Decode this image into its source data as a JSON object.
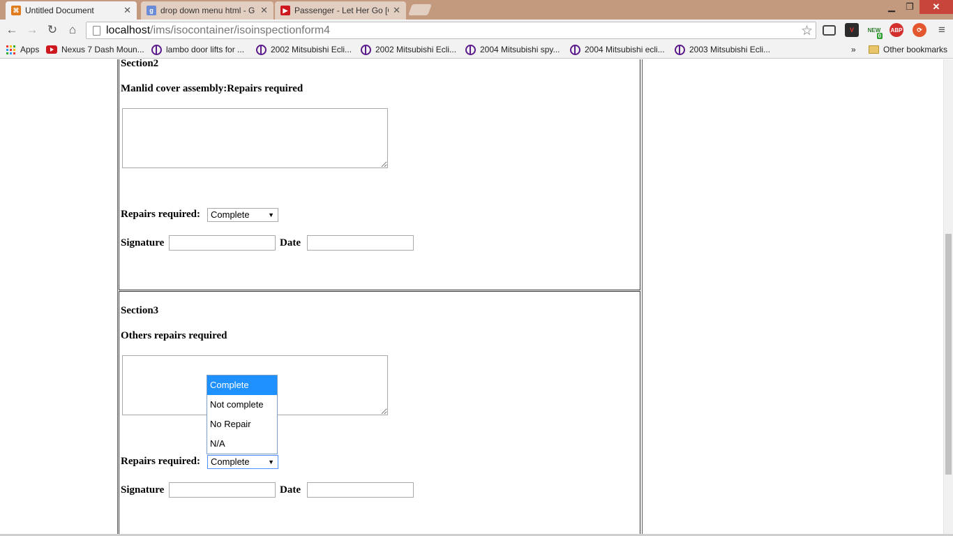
{
  "browser": {
    "tabs": [
      {
        "title": "Untitled Document",
        "active": true
      },
      {
        "title": "drop down menu html - G",
        "active": false
      },
      {
        "title": "Passenger - Let Her Go [O",
        "active": false
      }
    ],
    "url_host": "localhost",
    "url_path": "/ims/isocontainer/isoinspectionform4",
    "bookmarks": [
      "Apps",
      "Nexus 7 Dash Moun...",
      "lambo door lifts for ...",
      "2002 Mitsubishi Ecli...",
      "2002 Mitsubishi Ecli...",
      "2004 Mitsubishi spy...",
      "2004 Mitsubishi ecli...",
      "2003 Mitsubishi Ecli..."
    ],
    "overflow": "»",
    "other_bookmarks": "Other bookmarks",
    "extensions": {
      "new_badge": "NEW",
      "new_count": "0",
      "abp": "ABP"
    }
  },
  "form": {
    "section2": {
      "title": "Section2",
      "label": "Manlid cover assembly:Repairs required",
      "repairs_label": "Repairs required:",
      "repairs_value": "Complete",
      "signature_label": "Signature",
      "date_label": "Date"
    },
    "section3": {
      "title": "Section3",
      "label": "Others repairs required",
      "repairs_label": "Repairs required:",
      "repairs_value": "Complete",
      "signature_label": "Signature",
      "date_label": "Date"
    },
    "dropdown_options": [
      "Complete",
      "Not complete",
      "No Repair",
      "N/A"
    ],
    "selected_option_index": 0
  },
  "colors": {
    "tabstrip": "#c49a7e",
    "chrome": "#f2f2f2",
    "selection": "#1e90ff"
  }
}
